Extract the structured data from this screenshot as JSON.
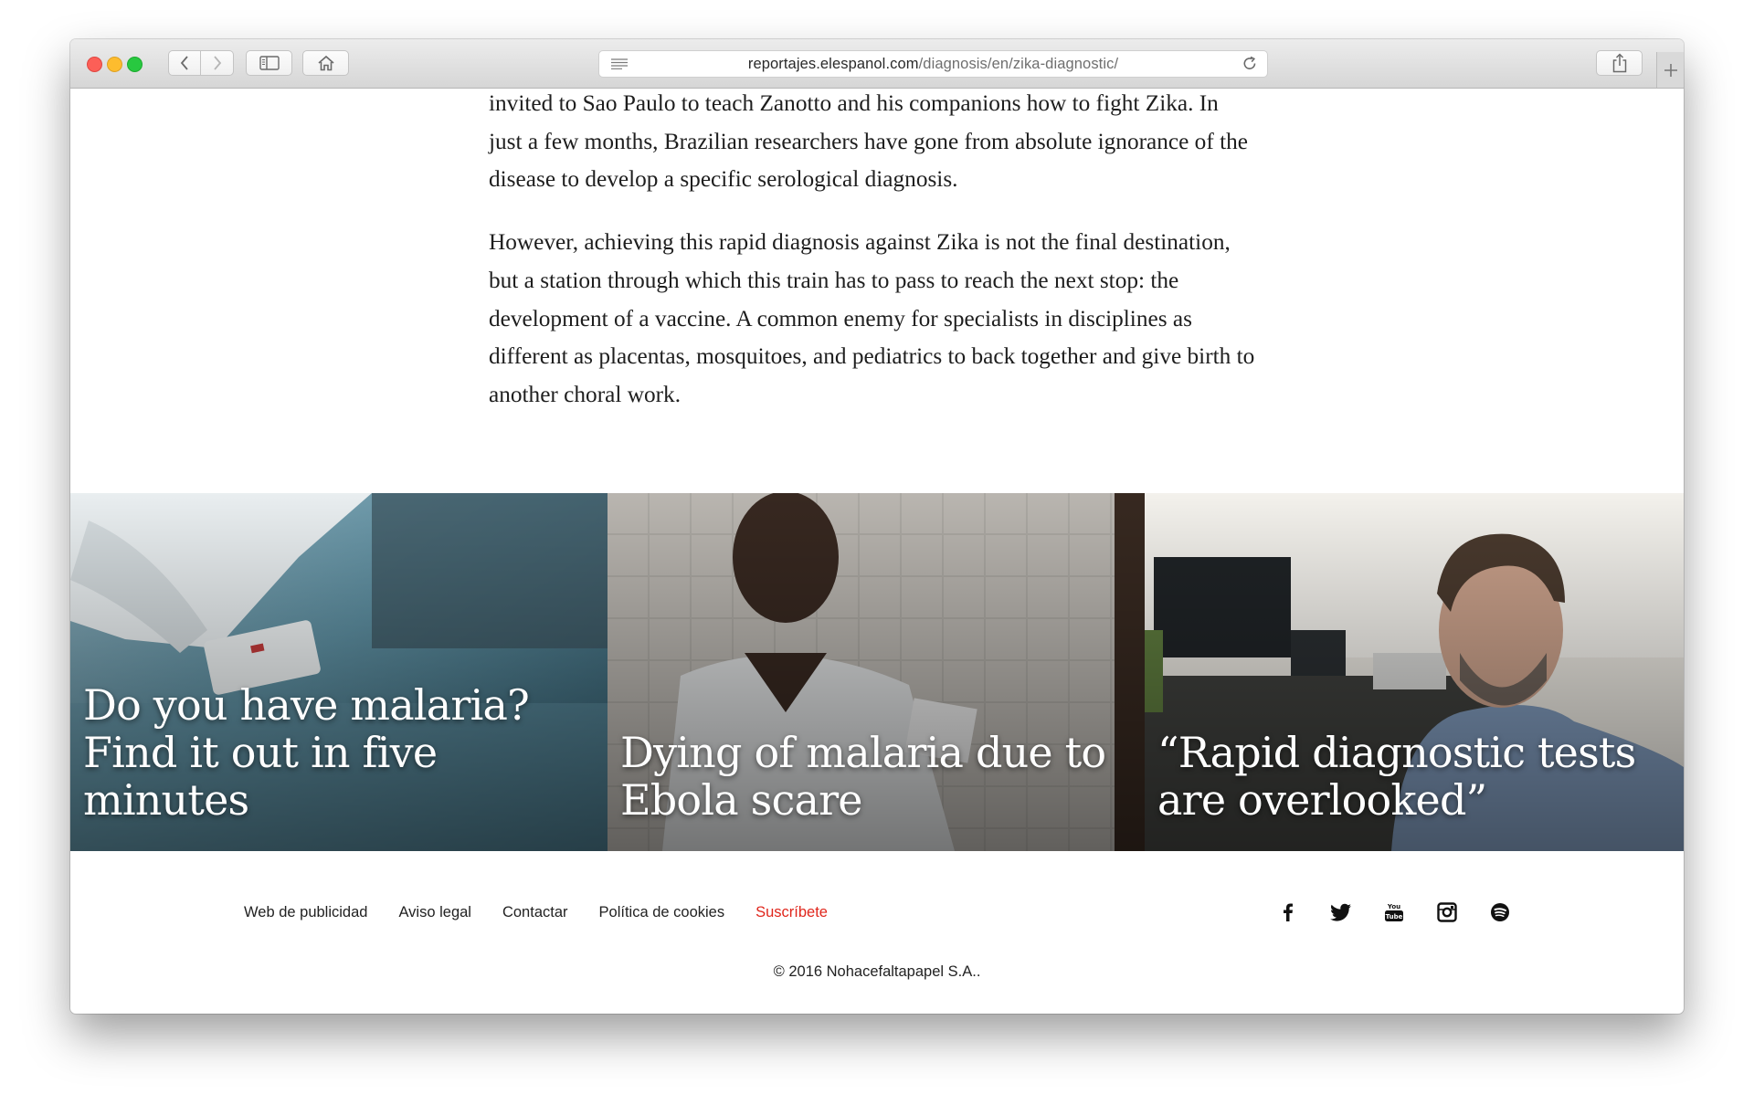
{
  "browser": {
    "url_domain": "reportajes.elespanol.com",
    "url_path": "/diagnosis/en/zika-diagnostic/"
  },
  "article": {
    "paragraphs": [
      "invited to Sao Paulo to teach Zanotto and his companions how to fight Zika. In just a few months, Brazilian researchers have gone from absolute ignorance of the disease to develop a specific serological diagnosis.",
      "However, achieving this rapid diagnosis against Zika is not the final destination, but a station through which this train has to pass to reach the next stop: the development of a vaccine. A common enemy for specialists in disciplines as different as placentas, mosquitoes, and pediatrics to back together and give birth to another choral work."
    ]
  },
  "related": [
    {
      "title": "Do you have malaria? Find it out in five minutes",
      "image": "malaria-rapid-test-photo"
    },
    {
      "title": "Dying of malaria due to Ebola scare",
      "image": "health-worker-photo"
    },
    {
      "title": "“Rapid diagnostic tests are overlooked”",
      "image": "researcher-office-photo"
    }
  ],
  "footer": {
    "links": [
      "Web de publicidad",
      "Aviso legal",
      "Contactar",
      "Política de cookies"
    ],
    "subscribe": "Suscríbete",
    "social": [
      "facebook-icon",
      "twitter-icon",
      "youtube-icon",
      "instagram-icon",
      "spotify-icon"
    ],
    "youtube_glyph": [
      "You",
      "Tube"
    ],
    "copyright": "© 2016 Nohacefaltapapel S.A.."
  },
  "colors": {
    "subscribe": "#e0261c",
    "text": "#1e1e1e"
  }
}
